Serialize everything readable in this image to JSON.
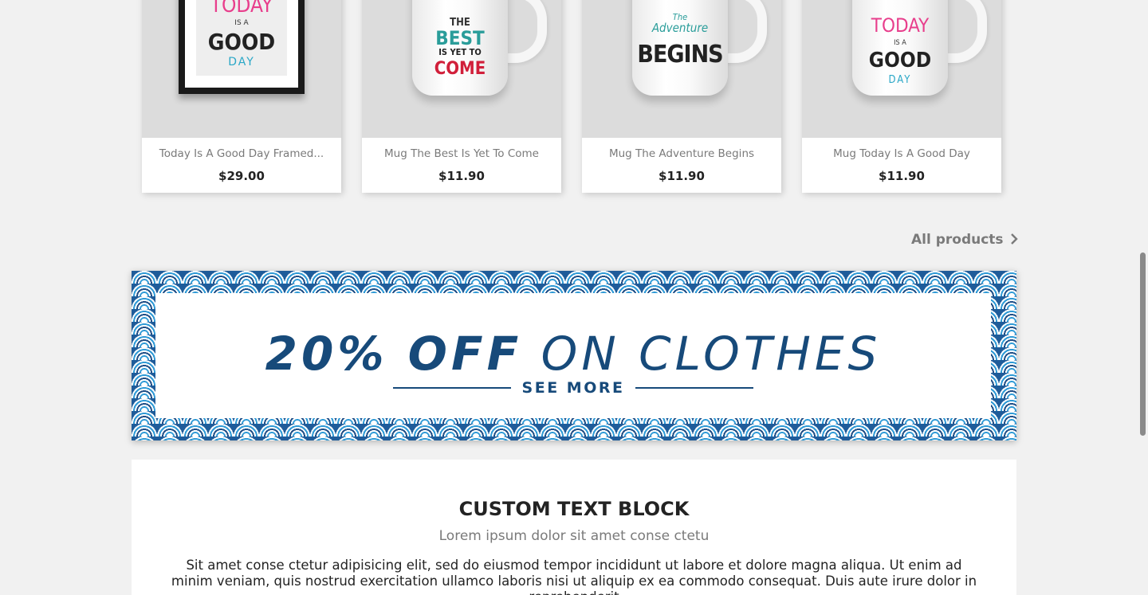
{
  "products": [
    {
      "name": "Today Is A Good Day Framed...",
      "price": "$29.00",
      "art": {
        "line1": "TODAY",
        "line2": "IS A",
        "line3": "GOOD",
        "line4": "DAY"
      }
    },
    {
      "name": "Mug The Best Is Yet To Come",
      "price": "$11.90",
      "art": {
        "line1": "THE",
        "line2": "BEST",
        "line3": "IS YET TO",
        "line4": "COME"
      }
    },
    {
      "name": "Mug The Adventure Begins",
      "price": "$11.90",
      "art": {
        "line1": "The",
        "line2": "Adventure",
        "line3": "BEGINS"
      }
    },
    {
      "name": "Mug Today Is A Good Day",
      "price": "$11.90",
      "art": {
        "line1": "TODAY",
        "line2": "IS A",
        "line3": "GOOD",
        "line4": "DAY"
      }
    }
  ],
  "all_products": {
    "label": "All products",
    "icon": "chevron-right-icon"
  },
  "banner": {
    "headline_strong": "20% OFF",
    "headline_light": "ON CLOTHES",
    "cta": "SEE MORE",
    "colors": {
      "text": "#174a7a",
      "pattern_dark": "#1f4e86",
      "pattern_light": "#2f9ad6"
    }
  },
  "custom_text": {
    "title": "CUSTOM TEXT BLOCK",
    "subtitle": "Lorem ipsum dolor sit amet conse ctetu",
    "body": "Sit amet conse ctetur adipisicing elit, sed do eiusmod tempor incididunt ut labore et dolore magna aliqua. Ut enim ad minim veniam, quis nostrud exercitation ullamco laboris nisi ut aliquip ex ea commodo consequat. Duis aute irure dolor in reprehenderit"
  }
}
